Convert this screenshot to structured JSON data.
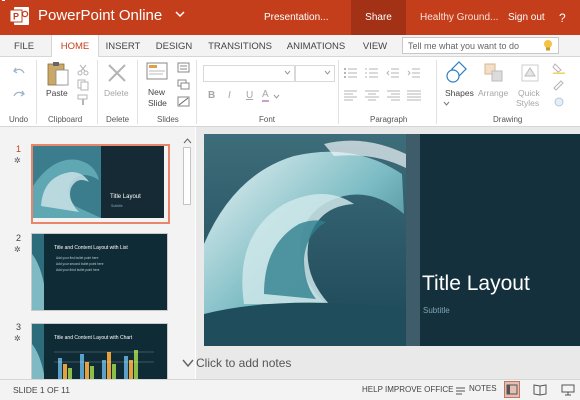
{
  "titlebar": {
    "app_title": "PowerPoint Online",
    "doc_name": "Presentation...",
    "share_label": "Share",
    "user_name": "Healthy Ground...",
    "signout_label": "Sign out",
    "help_label": "?"
  },
  "tabs": [
    {
      "label": "FILE"
    },
    {
      "label": "HOME",
      "active": true
    },
    {
      "label": "INSERT"
    },
    {
      "label": "DESIGN"
    },
    {
      "label": "TRANSITIONS"
    },
    {
      "label": "ANIMATIONS"
    },
    {
      "label": "VIEW"
    }
  ],
  "tellme_placeholder": "Tell me what you want to do",
  "ribbon": {
    "groups": {
      "undo": "Undo",
      "clipboard": "Clipboard",
      "delete": "Delete",
      "slides": "Slides",
      "font": "Font",
      "paragraph": "Paragraph",
      "drawing": "Drawing"
    },
    "paste_label": "Paste",
    "delete_label": "Delete",
    "new_slide_label_1": "New",
    "new_slide_label_2": "Slide",
    "shapes_label": "Shapes",
    "arrange_label": "Arrange",
    "quick_styles_label_1": "Quick",
    "quick_styles_label_2": "Styles",
    "font_buttons": [
      "B",
      "I",
      "U",
      "A"
    ]
  },
  "thumbnails": [
    {
      "number": "1",
      "title": "Title Layout",
      "subtitle": "Subtitle",
      "active": true
    },
    {
      "number": "2",
      "title": "Title and Content Layout with List",
      "bullets": [
        "Add your first bullet point here",
        "Add your second bullet point here",
        "Add your third bullet point here"
      ]
    },
    {
      "number": "3",
      "title": "Title and Content Layout with Chart"
    }
  ],
  "slide": {
    "title": "Title Layout",
    "subtitle": "Subtitle"
  },
  "notes_placeholder": "Click to add notes",
  "status": {
    "slide_count": "SLIDE 1 OF 11",
    "help_improve": "HELP IMPROVE OFFICE",
    "notes_label": "NOTES"
  },
  "colors": {
    "accent": "#c43e1c",
    "share_bg": "#a33115",
    "slide_panel": "#162b36"
  }
}
